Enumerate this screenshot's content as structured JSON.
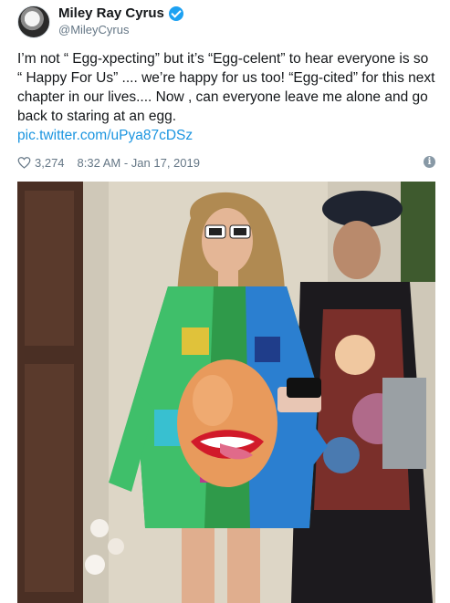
{
  "tweet": {
    "display_name": "Miley Ray Cyrus",
    "handle": "@MileyCyrus",
    "text": "I’m not “ Egg-xpecting” but it’s “Egg-celent” to hear everyone is so “ Happy For Us” .... we’re happy for us too! “Egg-cited” for this next chapter in our lives.... Now , can everyone leave me alone and go back to staring at an egg.",
    "link": "pic.twitter.com/uPya87cDSz",
    "likes": "3,274",
    "timestamp": "8:32 AM - Jan 17, 2019",
    "info_glyph": "i"
  },
  "icons": {
    "verified": "verified-badge-icon",
    "like": "heart-icon",
    "info": "info-icon"
  },
  "colors": {
    "link": "#1b95e0",
    "verified": "#1da1f2",
    "secondary_text": "#657786"
  }
}
